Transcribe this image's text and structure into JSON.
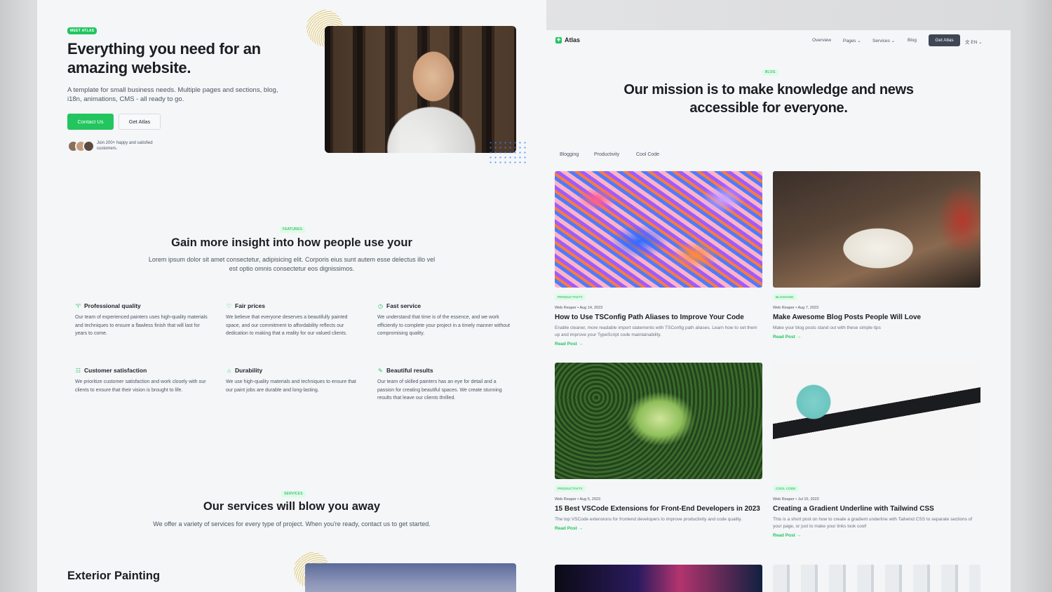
{
  "left": {
    "hero": {
      "badge": "MEET ATLAS",
      "title": "Everything you need for an amazing website.",
      "subtitle": "A template for small business needs. Multiple pages and sections, blog, i18n, animations, CMS - all ready to go.",
      "primary_button": "Contact Us",
      "secondary_button": "Get Atlas",
      "social_proof": "Join 200+ happy and satisfied customers."
    },
    "features": {
      "tag": "FEATURES",
      "title": "Gain more insight into how people use your",
      "description": "Lorem ipsum dolor sit amet consectetur, adipisicing elit. Corporis eius sunt autem esse delectus illo vel est optio omnis consectetur eos dignissimos.",
      "items": [
        {
          "icon": "award-icon",
          "title": "Professional quality",
          "text": "Our team of experienced painters uses high-quality materials and techniques to ensure a flawless finish that will last for years to come."
        },
        {
          "icon": "heart-icon",
          "title": "Fair prices",
          "text": "We believe that everyone deserves a beautifully painted space, and our commitment to affordability reflects our dedication to making that a reality for our valued clients."
        },
        {
          "icon": "clock-icon",
          "title": "Fast service",
          "text": "We understand that time is of the essence, and we work efficiently to complete your project in a timely manner without compromising quality."
        },
        {
          "icon": "list-icon",
          "title": "Customer satisfaction",
          "text": "We prioritize customer satisfaction and work closely with our clients to ensure that their vision is brought to life."
        },
        {
          "icon": "home-icon",
          "title": "Durability",
          "text": "We use high-quality materials and techniques to ensure that our paint jobs are durable and long-lasting."
        },
        {
          "icon": "paint-roller-icon",
          "title": "Beautiful results",
          "text": "Our team of skilled painters has an eye for detail and a passion for creating beautiful spaces. We create stunning results that leave our clients thrilled."
        }
      ]
    },
    "services": {
      "tag": "SERVICES",
      "title": "Our services will blow you away",
      "description": "We offer a variety of services for every type of project. When you're ready, contact us to get started.",
      "first_service": "Exterior Painting"
    }
  },
  "right": {
    "nav": {
      "logo": "Atlas",
      "items": [
        "Overview",
        "Pages ⌄",
        "Services ⌄",
        "Blog"
      ],
      "cta": "Get Atlas",
      "language": "文 EN ⌄"
    },
    "blog": {
      "tag": "BLOG",
      "title": "Our mission is to make knowledge and news accessible for everyone.",
      "filters": [
        "Blogging",
        "Productivity",
        "Cool Code"
      ],
      "read_more": "Read Post →",
      "posts": [
        {
          "category": "PRODUCTIVITY",
          "meta": "Web Reaper • Aug 14, 2023",
          "title": "How to Use TSConfig Path Aliases to Improve Your Code",
          "excerpt": "Enable cleaner, more readable import statements with TSConfig path aliases. Learn how to set them up and improve your TypeScript code maintainability."
        },
        {
          "category": "BLOGGING",
          "meta": "Web Reaper • Aug 7, 2023",
          "title": "Make Awesome Blog Posts People Will Love",
          "excerpt": "Make your blog posts stand out with these simple tips"
        },
        {
          "category": "PRODUCTIVITY",
          "meta": "Web Reaper • Aug 5, 2023",
          "title": "15 Best VSCode Extensions for Front-End Developers in 2023",
          "excerpt": "The top VSCode extensions for frontend developers to improve productivity and code quality."
        },
        {
          "category": "COOL CODE",
          "meta": "Web Reaper • Jul 10, 2023",
          "title": "Creating a Gradient Underline with Tailwind CSS",
          "excerpt": "This is a short post on how to create a gradient underline with Tailwind CSS to separate sections of your page, or just to make your links look cool!"
        }
      ]
    }
  }
}
